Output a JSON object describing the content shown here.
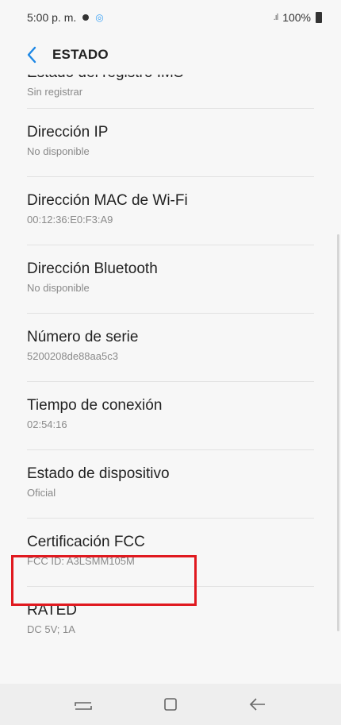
{
  "status_bar": {
    "time": "5:00 p. m.",
    "battery_percent": "100%",
    "notification_icon": "notification-icon"
  },
  "header": {
    "title": "ESTADO",
    "back_icon": "chevron-left-icon"
  },
  "items": [
    {
      "title": "Estado del registro IMS",
      "subtitle": "Sin registrar"
    },
    {
      "title": "Dirección IP",
      "subtitle": "No disponible"
    },
    {
      "title": "Dirección MAC de Wi-Fi",
      "subtitle": "00:12:36:E0:F3:A9"
    },
    {
      "title": "Dirección Bluetooth",
      "subtitle": "No disponible"
    },
    {
      "title": "Número de serie",
      "subtitle": "5200208de88aa5c3"
    },
    {
      "title": "Tiempo de conexión",
      "subtitle": "02:54:16"
    },
    {
      "title": "Estado de dispositivo",
      "subtitle": "Oficial"
    },
    {
      "title": "Certificación FCC",
      "subtitle": "FCC ID: A3LSMM105M"
    },
    {
      "title": "RATED",
      "subtitle": "DC 5V; 1A"
    }
  ],
  "navigation": {
    "recent_icon": "recent-apps-icon",
    "home_icon": "home-icon",
    "back_icon": "back-arrow-icon"
  },
  "colors": {
    "accent": "#1e88e5",
    "highlight": "#e0191f",
    "background": "#f7f7f7"
  }
}
